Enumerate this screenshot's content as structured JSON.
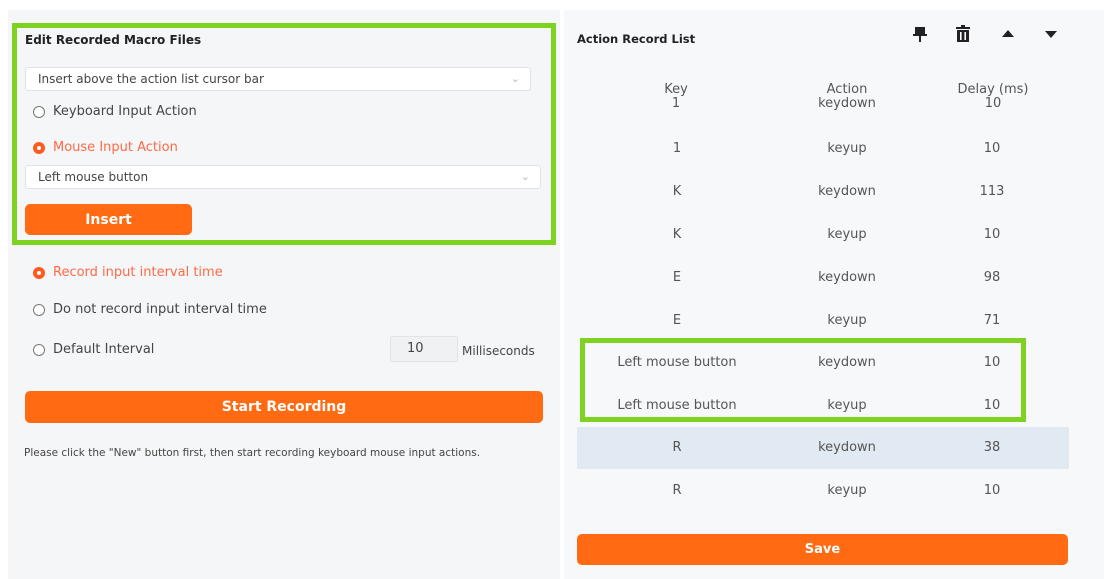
{
  "left": {
    "section_title": "Edit Recorded Macro Files",
    "insert_position_select": "Insert above the action list cursor bar",
    "keyboard_radio": "Keyboard Input Action",
    "mouse_radio": "Mouse Input Action",
    "mouse_button_select": "Left mouse button",
    "insert_button": "Insert",
    "record_interval_radio": "Record input interval time",
    "no_record_interval_radio": "Do not record input interval time",
    "default_interval_radio": "Default Interval",
    "default_interval_value": "10",
    "milliseconds_label": "Milliseconds",
    "start_recording_button": "Start Recording",
    "hint": "Please click the \"New\" button first, then start recording keyboard mouse input actions."
  },
  "right": {
    "title": "Action Record List",
    "icons": [
      "pin-icon",
      "trash-icon",
      "move-up-icon",
      "move-down-icon"
    ],
    "columns": {
      "key": "Key",
      "action": "Action",
      "delay": "Delay (ms)"
    },
    "first_row": {
      "key": "1",
      "action": "keydown",
      "delay": "10"
    },
    "rows": [
      {
        "key": "1",
        "action": "keyup",
        "delay": "10"
      },
      {
        "key": "K",
        "action": "keydown",
        "delay": "113"
      },
      {
        "key": "K",
        "action": "keyup",
        "delay": "10"
      },
      {
        "key": "E",
        "action": "keydown",
        "delay": "98"
      },
      {
        "key": "E",
        "action": "keyup",
        "delay": "71"
      },
      {
        "key": "Left mouse button",
        "action": "keydown",
        "delay": "10"
      },
      {
        "key": "Left mouse button",
        "action": "keyup",
        "delay": "10"
      },
      {
        "key": "R",
        "action": "keydown",
        "delay": "38"
      },
      {
        "key": "R",
        "action": "keyup",
        "delay": "10"
      }
    ],
    "save_button": "Save"
  },
  "colors": {
    "accent": "#ff6a13",
    "highlight_frame": "#7ed321",
    "selected_row": "#e1e9f2"
  }
}
